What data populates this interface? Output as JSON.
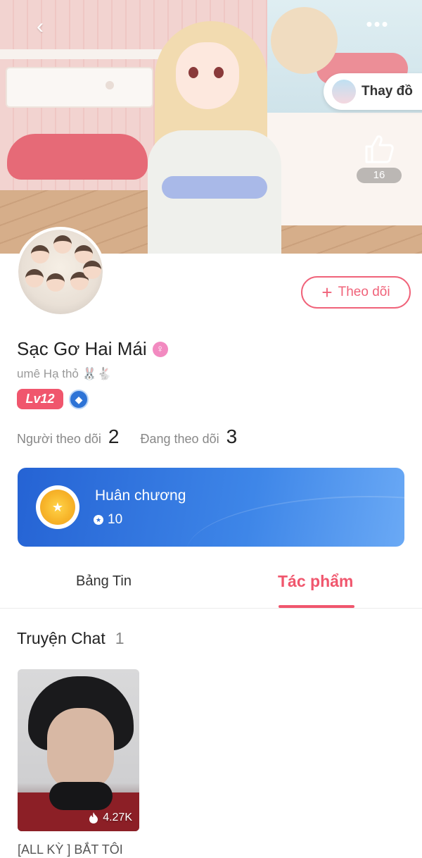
{
  "header": {
    "back_icon": "chevron-left-icon",
    "more_icon": "more-dots-icon",
    "back_glyph": "‹",
    "more_glyph": "•••"
  },
  "cover": {
    "change_outfit_label": "Thay đồ",
    "like_count": "16"
  },
  "profile": {
    "follow_plus": "+",
    "follow_label": "Theo dõi",
    "name": "Sạc Gơ Hai Mái",
    "gender_glyph": "♀",
    "bio": "umê Hạ thỏ 🐰🐇",
    "level": "Lv12",
    "rank_glyph": "◆",
    "followers_label": "Người theo dõi",
    "followers_count": "2",
    "following_label": "Đang theo dõi",
    "following_count": "3"
  },
  "medal": {
    "title": "Huân chương",
    "points": "10",
    "sun_glyph": "★",
    "dot_glyph": "★"
  },
  "tabs": [
    {
      "label": "Bảng Tin",
      "active": false
    },
    {
      "label": "Tác phẩm",
      "active": true
    }
  ],
  "works": {
    "section_title": "Truyện Chat",
    "count": "1",
    "items": [
      {
        "title": "[ALL KỲ ] BẮT TÔI",
        "views": "4.27K",
        "views_icon": "flame-icon"
      }
    ]
  },
  "colors": {
    "accent": "#f0566d",
    "medal_blue": "#2d73d6"
  }
}
